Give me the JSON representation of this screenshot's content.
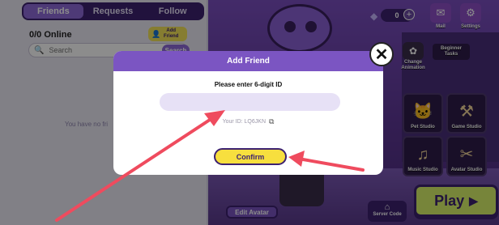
{
  "friends_panel": {
    "tabs": [
      {
        "label": "Friends",
        "active": true
      },
      {
        "label": "Requests",
        "active": false
      },
      {
        "label": "Follow",
        "active": false
      }
    ],
    "online_count": "0/0 Online",
    "add_friend_label": "Add Friend",
    "search_placeholder": "Search",
    "search_button": "Search",
    "empty_message": "You have no fri"
  },
  "hud": {
    "currency": "0",
    "mail_label": "Mail",
    "settings_label": "Settings"
  },
  "side_buttons": {
    "change_animation": "Change Animation",
    "beginner_tasks": "Beginner Tasks"
  },
  "studios": [
    {
      "label": "Pet Studio",
      "icon": "cat-icon"
    },
    {
      "label": "Game Studio",
      "icon": "tools-icon"
    },
    {
      "label": "Music Studio",
      "icon": "guitar-icon"
    },
    {
      "label": "Avatar Studio",
      "icon": "sewing-machine-icon"
    }
  ],
  "play_label": "Play",
  "edit_avatar_label": "Edit Avatar",
  "server_code_label": "Server Code",
  "dialog": {
    "title": "Add Friend",
    "prompt": "Please enter 6-digit ID",
    "input_value": "",
    "your_id": "Your ID: LQ6JKN",
    "confirm_label": "Confirm"
  },
  "colors": {
    "accent_purple": "#7b55c2",
    "confirm_yellow": "#f7df3e",
    "play_green": "#d9f36a",
    "arrow_red": "#ef4b5e"
  }
}
